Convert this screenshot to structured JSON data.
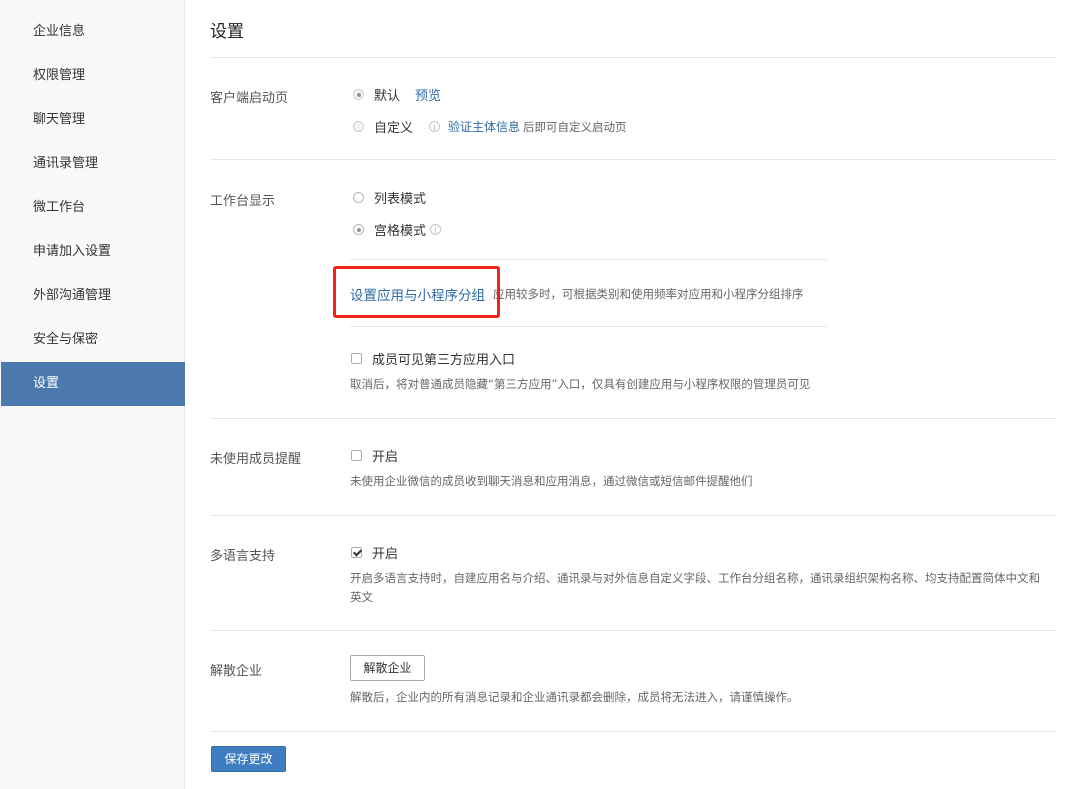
{
  "sidebar": {
    "items": [
      {
        "label": "企业信息"
      },
      {
        "label": "权限管理"
      },
      {
        "label": "聊天管理"
      },
      {
        "label": "通讯录管理"
      },
      {
        "label": "微工作台"
      },
      {
        "label": "申请加入设置"
      },
      {
        "label": "外部沟通管理"
      },
      {
        "label": "安全与保密"
      },
      {
        "label": "设置",
        "active": true
      }
    ]
  },
  "main": {
    "title": "设置",
    "client_startup": {
      "label": "客户端启动页",
      "default_label": "默认",
      "preview_link": "预览",
      "custom_label": "自定义",
      "verify_link": "验证主体信息",
      "verify_suffix": "后即可自定义启动页"
    },
    "workbench": {
      "label": "工作台显示",
      "list_mode": "列表模式",
      "grid_mode": "宫格模式",
      "group_link": "设置应用与小程序分组",
      "group_desc": "应用较多时，可根据类别和使用频率对应用和小程序分组排序",
      "third_party_label": "成员可见第三方应用入口",
      "third_party_desc": "取消后，将对普通成员隐藏“第三方应用”入口，仅具有创建应用与小程序权限的管理员可见"
    },
    "unused_reminder": {
      "label": "未使用成员提醒",
      "enable_label": "开启",
      "desc": "未使用企业微信的成员收到聊天消息和应用消息，通过微信或短信邮件提醒他们"
    },
    "multilang": {
      "label": "多语言支持",
      "enable_label": "开启",
      "desc": "开启多语言支持时，自建应用名与介绍、通讯录与对外信息自定义字段、工作台分组名称，通讯录组织架构名称、均支持配置简体中文和英文"
    },
    "dissolve": {
      "label": "解散企业",
      "button_label": "解散企业",
      "desc": "解散后，企业内的所有消息记录和企业通讯录都会删除，成员将无法进入，请谨慎操作。"
    },
    "save_label": "保存更改"
  },
  "colors": {
    "accent": "#4b79ad",
    "link": "#2e6aa8",
    "primary_button": "#3f7dc1",
    "highlight_box": "#f5211a"
  }
}
